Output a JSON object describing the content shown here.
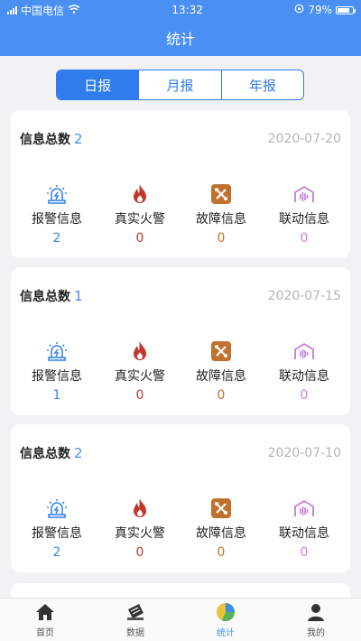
{
  "status": {
    "carrier": "中国电信",
    "time": "13:32",
    "battery": "79%",
    "battery_level": 0.79
  },
  "nav": {
    "title": "统计"
  },
  "segments": [
    {
      "label": "日报",
      "active": true
    },
    {
      "label": "月报",
      "active": false
    },
    {
      "label": "年报",
      "active": false
    }
  ],
  "cards": [
    {
      "title": "信息总数",
      "count": "2",
      "date": "2020-07-20",
      "stats": [
        {
          "label": "报警信息",
          "value": "2",
          "icon": "alarm-light-icon",
          "color": "#3a86e8"
        },
        {
          "label": "真实火警",
          "value": "0",
          "icon": "fire-icon",
          "color": "#c0392b"
        },
        {
          "label": "故障信息",
          "value": "0",
          "icon": "fault-tools-icon",
          "color": "#c0712d"
        },
        {
          "label": "联动信息",
          "value": "0",
          "icon": "linkage-icon",
          "color": "#c77ddb"
        }
      ]
    },
    {
      "title": "信息总数",
      "count": "1",
      "date": "2020-07-15",
      "stats": [
        {
          "label": "报警信息",
          "value": "1",
          "icon": "alarm-light-icon",
          "color": "#3a86e8"
        },
        {
          "label": "真实火警",
          "value": "0",
          "icon": "fire-icon",
          "color": "#c0392b"
        },
        {
          "label": "故障信息",
          "value": "0",
          "icon": "fault-tools-icon",
          "color": "#c0712d"
        },
        {
          "label": "联动信息",
          "value": "0",
          "icon": "linkage-icon",
          "color": "#c77ddb"
        }
      ]
    },
    {
      "title": "信息总数",
      "count": "2",
      "date": "2020-07-10",
      "stats": [
        {
          "label": "报警信息",
          "value": "2",
          "icon": "alarm-light-icon",
          "color": "#3a86e8"
        },
        {
          "label": "真实火警",
          "value": "0",
          "icon": "fire-icon",
          "color": "#c0392b"
        },
        {
          "label": "故障信息",
          "value": "0",
          "icon": "fault-tools-icon",
          "color": "#c0712d"
        },
        {
          "label": "联动信息",
          "value": "0",
          "icon": "linkage-icon",
          "color": "#c77ddb"
        }
      ]
    }
  ],
  "tabs": [
    {
      "label": "首页",
      "icon": "home-icon",
      "active": false
    },
    {
      "label": "数据",
      "icon": "data-icon",
      "active": false
    },
    {
      "label": "统计",
      "icon": "statistics-icon",
      "active": true
    },
    {
      "label": "我的",
      "icon": "profile-icon",
      "active": false
    }
  ],
  "colors": {
    "primary": "#4a8ff2",
    "segment": "#2f7ded"
  }
}
